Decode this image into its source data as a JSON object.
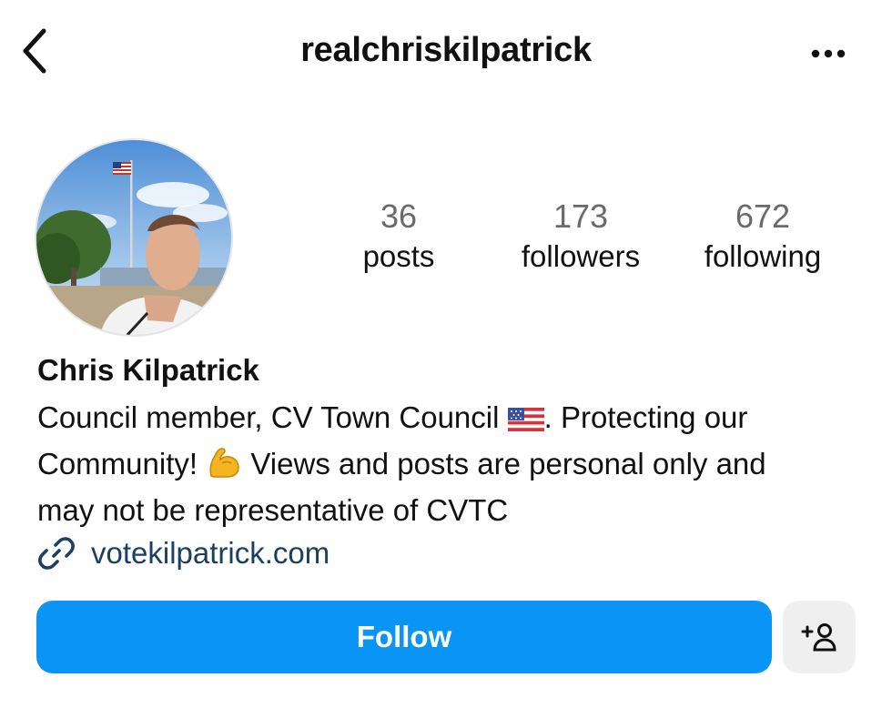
{
  "header": {
    "username": "realchriskilpatrick",
    "back_icon": "chevron-left-icon",
    "more_icon": "more-horizontal-icon"
  },
  "profile": {
    "avatar_icon": "profile-photo",
    "stats": {
      "posts": {
        "count": "36",
        "label": "posts"
      },
      "followers": {
        "count": "173",
        "label": "followers"
      },
      "following": {
        "count": "672",
        "label": "following"
      }
    },
    "display_name": "Chris Kilpatrick",
    "bio": {
      "line1_a": "Council member, CV Town Council ",
      "line1_b": ". Protecting our",
      "line2_a": "Community! ",
      "line2_b": " Views and posts are personal only and",
      "line3": "may not be representative of CVTC",
      "flag_emoji_icon": "us-flag-emoji",
      "muscle_emoji_icon": "flexed-biceps-emoji"
    },
    "link": {
      "text": "votekilpatrick.com",
      "icon": "link-icon"
    }
  },
  "actions": {
    "follow_label": "Follow",
    "suggest_icon": "add-person-icon"
  },
  "colors": {
    "follow_bg": "#0a95f6",
    "secondary_btn_bg": "#efefef",
    "link_text": "#1b3f63",
    "stat_number": "#6a6a6a"
  }
}
